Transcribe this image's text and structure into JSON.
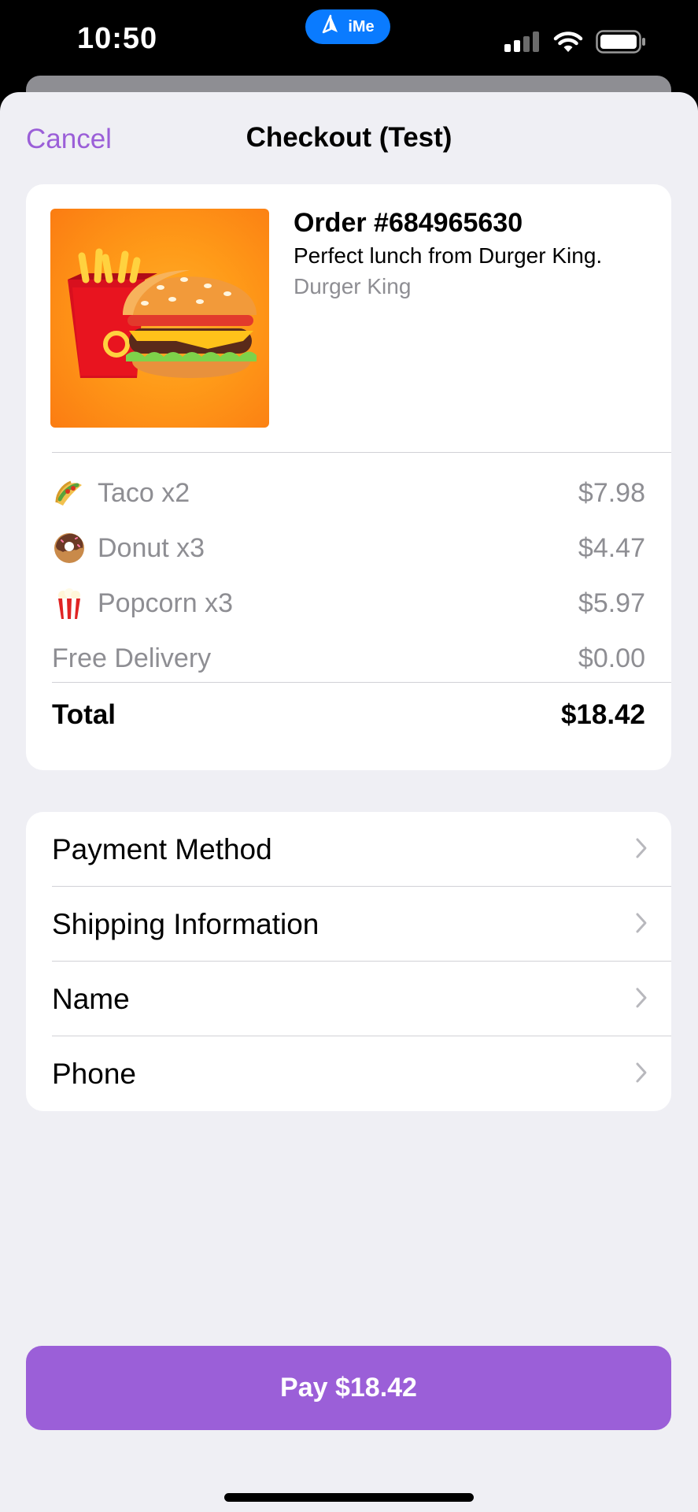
{
  "status_bar": {
    "time": "10:50",
    "pill_label": "iMe"
  },
  "nav": {
    "cancel_label": "Cancel",
    "title": "Checkout (Test)"
  },
  "order": {
    "title": "Order #684965630",
    "description": "Perfect lunch from Durger King.",
    "merchant": "Durger King",
    "items": [
      {
        "icon": "taco-icon",
        "label": "Taco x2",
        "price": "$7.98"
      },
      {
        "icon": "donut-icon",
        "label": "Donut x3",
        "price": "$4.47"
      },
      {
        "icon": "popcorn-icon",
        "label": "Popcorn x3",
        "price": "$5.97"
      },
      {
        "icon": "",
        "label": "Free Delivery",
        "price": "$0.00"
      }
    ],
    "total_label": "Total",
    "total_value": "$18.42"
  },
  "info_rows": [
    {
      "label": "Payment Method"
    },
    {
      "label": "Shipping Information"
    },
    {
      "label": "Name"
    },
    {
      "label": "Phone"
    }
  ],
  "pay_button": {
    "label": "Pay $18.42"
  },
  "colors": {
    "accent": "#9b5fd8",
    "background": "#efeff4",
    "secondary_text": "#8e8e93",
    "ime_blue": "#0a7bff"
  }
}
